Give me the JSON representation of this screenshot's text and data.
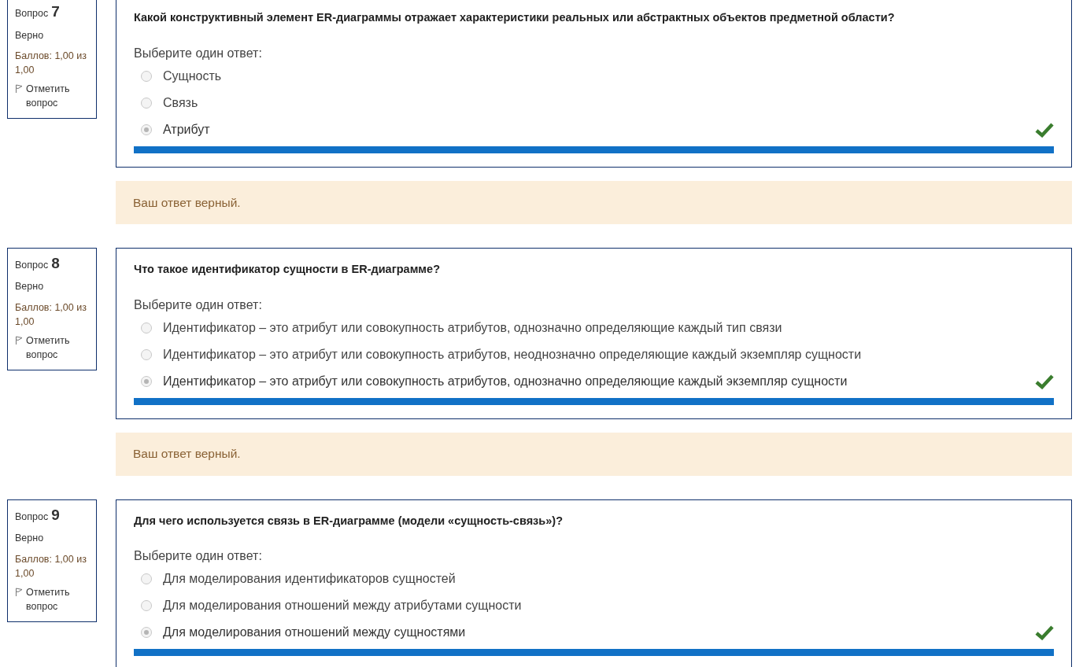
{
  "questions": [
    {
      "label": "Вопрос",
      "number": "7",
      "status": "Верно",
      "score": "Баллов: 1,00 из 1,00",
      "flag": "Отметить вопрос",
      "text": "Какой конструктивный элемент ER-диаграммы отражает характеристики реальных или абстрактных объектов предметной области?",
      "prompt": "Выберите один ответ:",
      "options": [
        {
          "text": "Сущность",
          "selected": false
        },
        {
          "text": "Связь",
          "selected": false
        },
        {
          "text": "Атрибут",
          "selected": true
        }
      ],
      "feedback": "Ваш ответ верный."
    },
    {
      "label": "Вопрос",
      "number": "8",
      "status": "Верно",
      "score": "Баллов: 1,00 из 1,00",
      "flag": "Отметить вопрос",
      "text": "Что такое идентификатор сущности в ER-диаграмме?",
      "prompt": "Выберите один ответ:",
      "options": [
        {
          "text": "Идентификатор – это атрибут или совокупность атрибутов, однозначно определяющие каждый тип связи",
          "selected": false
        },
        {
          "text": "Идентификатор – это атрибут или совокупность атрибутов, неоднозначно определяющие каждый экземпляр сущности",
          "selected": false
        },
        {
          "text": "Идентификатор – это атрибут или совокупность атрибутов, однозначно определяющие каждый экземпляр сущности",
          "selected": true
        }
      ],
      "feedback": "Ваш ответ верный."
    },
    {
      "label": "Вопрос",
      "number": "9",
      "status": "Верно",
      "score": "Баллов: 1,00 из 1,00",
      "flag": "Отметить вопрос",
      "text": "Для чего используется связь в ER-диаграмме (модели «сущность-связь»)?",
      "prompt": "Выберите один ответ:",
      "options": [
        {
          "text": "Для моделирования идентификаторов сущностей",
          "selected": false
        },
        {
          "text": "Для моделирования отношений между атрибутами сущности",
          "selected": false
        },
        {
          "text": "Для моделирования отношений между сущностями",
          "selected": true
        }
      ]
    }
  ]
}
